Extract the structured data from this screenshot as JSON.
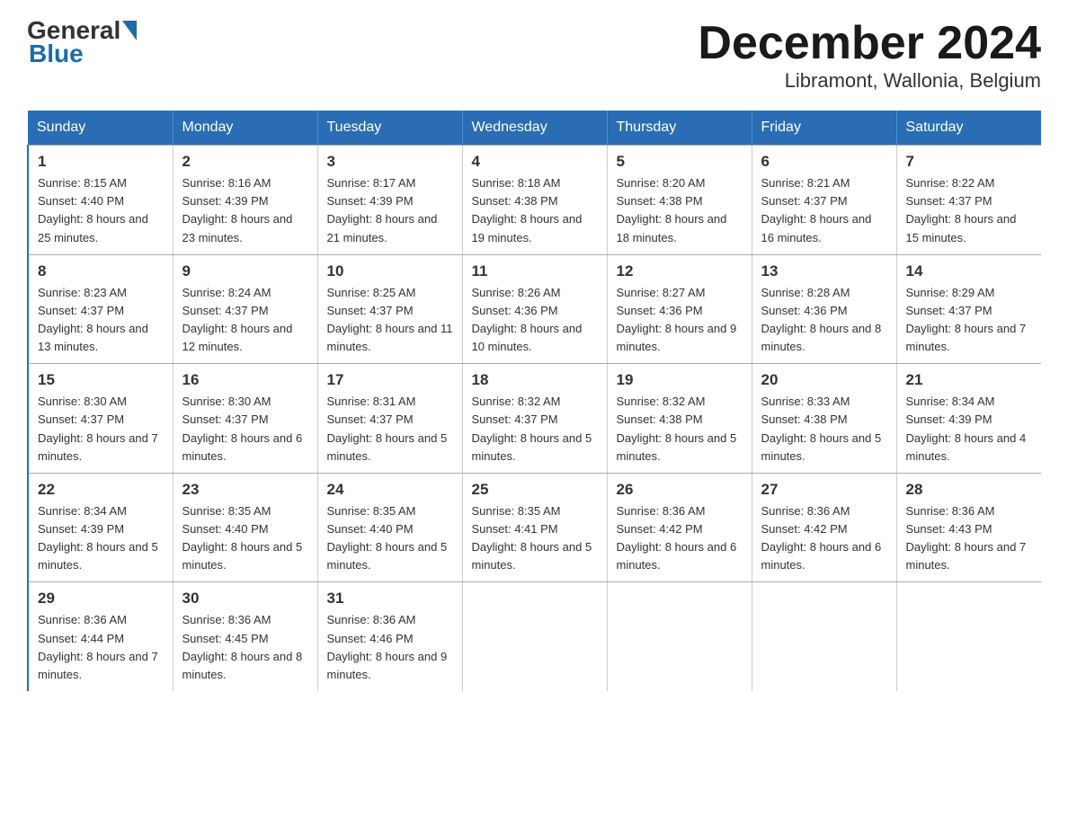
{
  "header": {
    "logo_general": "General",
    "logo_blue": "Blue",
    "title": "December 2024",
    "subtitle": "Libramont, Wallonia, Belgium"
  },
  "days_of_week": [
    "Sunday",
    "Monday",
    "Tuesday",
    "Wednesday",
    "Thursday",
    "Friday",
    "Saturday"
  ],
  "weeks": [
    [
      {
        "date": "1",
        "sunrise": "Sunrise: 8:15 AM",
        "sunset": "Sunset: 4:40 PM",
        "daylight": "Daylight: 8 hours and 25 minutes."
      },
      {
        "date": "2",
        "sunrise": "Sunrise: 8:16 AM",
        "sunset": "Sunset: 4:39 PM",
        "daylight": "Daylight: 8 hours and 23 minutes."
      },
      {
        "date": "3",
        "sunrise": "Sunrise: 8:17 AM",
        "sunset": "Sunset: 4:39 PM",
        "daylight": "Daylight: 8 hours and 21 minutes."
      },
      {
        "date": "4",
        "sunrise": "Sunrise: 8:18 AM",
        "sunset": "Sunset: 4:38 PM",
        "daylight": "Daylight: 8 hours and 19 minutes."
      },
      {
        "date": "5",
        "sunrise": "Sunrise: 8:20 AM",
        "sunset": "Sunset: 4:38 PM",
        "daylight": "Daylight: 8 hours and 18 minutes."
      },
      {
        "date": "6",
        "sunrise": "Sunrise: 8:21 AM",
        "sunset": "Sunset: 4:37 PM",
        "daylight": "Daylight: 8 hours and 16 minutes."
      },
      {
        "date": "7",
        "sunrise": "Sunrise: 8:22 AM",
        "sunset": "Sunset: 4:37 PM",
        "daylight": "Daylight: 8 hours and 15 minutes."
      }
    ],
    [
      {
        "date": "8",
        "sunrise": "Sunrise: 8:23 AM",
        "sunset": "Sunset: 4:37 PM",
        "daylight": "Daylight: 8 hours and 13 minutes."
      },
      {
        "date": "9",
        "sunrise": "Sunrise: 8:24 AM",
        "sunset": "Sunset: 4:37 PM",
        "daylight": "Daylight: 8 hours and 12 minutes."
      },
      {
        "date": "10",
        "sunrise": "Sunrise: 8:25 AM",
        "sunset": "Sunset: 4:37 PM",
        "daylight": "Daylight: 8 hours and 11 minutes."
      },
      {
        "date": "11",
        "sunrise": "Sunrise: 8:26 AM",
        "sunset": "Sunset: 4:36 PM",
        "daylight": "Daylight: 8 hours and 10 minutes."
      },
      {
        "date": "12",
        "sunrise": "Sunrise: 8:27 AM",
        "sunset": "Sunset: 4:36 PM",
        "daylight": "Daylight: 8 hours and 9 minutes."
      },
      {
        "date": "13",
        "sunrise": "Sunrise: 8:28 AM",
        "sunset": "Sunset: 4:36 PM",
        "daylight": "Daylight: 8 hours and 8 minutes."
      },
      {
        "date": "14",
        "sunrise": "Sunrise: 8:29 AM",
        "sunset": "Sunset: 4:37 PM",
        "daylight": "Daylight: 8 hours and 7 minutes."
      }
    ],
    [
      {
        "date": "15",
        "sunrise": "Sunrise: 8:30 AM",
        "sunset": "Sunset: 4:37 PM",
        "daylight": "Daylight: 8 hours and 7 minutes."
      },
      {
        "date": "16",
        "sunrise": "Sunrise: 8:30 AM",
        "sunset": "Sunset: 4:37 PM",
        "daylight": "Daylight: 8 hours and 6 minutes."
      },
      {
        "date": "17",
        "sunrise": "Sunrise: 8:31 AM",
        "sunset": "Sunset: 4:37 PM",
        "daylight": "Daylight: 8 hours and 5 minutes."
      },
      {
        "date": "18",
        "sunrise": "Sunrise: 8:32 AM",
        "sunset": "Sunset: 4:37 PM",
        "daylight": "Daylight: 8 hours and 5 minutes."
      },
      {
        "date": "19",
        "sunrise": "Sunrise: 8:32 AM",
        "sunset": "Sunset: 4:38 PM",
        "daylight": "Daylight: 8 hours and 5 minutes."
      },
      {
        "date": "20",
        "sunrise": "Sunrise: 8:33 AM",
        "sunset": "Sunset: 4:38 PM",
        "daylight": "Daylight: 8 hours and 5 minutes."
      },
      {
        "date": "21",
        "sunrise": "Sunrise: 8:34 AM",
        "sunset": "Sunset: 4:39 PM",
        "daylight": "Daylight: 8 hours and 4 minutes."
      }
    ],
    [
      {
        "date": "22",
        "sunrise": "Sunrise: 8:34 AM",
        "sunset": "Sunset: 4:39 PM",
        "daylight": "Daylight: 8 hours and 5 minutes."
      },
      {
        "date": "23",
        "sunrise": "Sunrise: 8:35 AM",
        "sunset": "Sunset: 4:40 PM",
        "daylight": "Daylight: 8 hours and 5 minutes."
      },
      {
        "date": "24",
        "sunrise": "Sunrise: 8:35 AM",
        "sunset": "Sunset: 4:40 PM",
        "daylight": "Daylight: 8 hours and 5 minutes."
      },
      {
        "date": "25",
        "sunrise": "Sunrise: 8:35 AM",
        "sunset": "Sunset: 4:41 PM",
        "daylight": "Daylight: 8 hours and 5 minutes."
      },
      {
        "date": "26",
        "sunrise": "Sunrise: 8:36 AM",
        "sunset": "Sunset: 4:42 PM",
        "daylight": "Daylight: 8 hours and 6 minutes."
      },
      {
        "date": "27",
        "sunrise": "Sunrise: 8:36 AM",
        "sunset": "Sunset: 4:42 PM",
        "daylight": "Daylight: 8 hours and 6 minutes."
      },
      {
        "date": "28",
        "sunrise": "Sunrise: 8:36 AM",
        "sunset": "Sunset: 4:43 PM",
        "daylight": "Daylight: 8 hours and 7 minutes."
      }
    ],
    [
      {
        "date": "29",
        "sunrise": "Sunrise: 8:36 AM",
        "sunset": "Sunset: 4:44 PM",
        "daylight": "Daylight: 8 hours and 7 minutes."
      },
      {
        "date": "30",
        "sunrise": "Sunrise: 8:36 AM",
        "sunset": "Sunset: 4:45 PM",
        "daylight": "Daylight: 8 hours and 8 minutes."
      },
      {
        "date": "31",
        "sunrise": "Sunrise: 8:36 AM",
        "sunset": "Sunset: 4:46 PM",
        "daylight": "Daylight: 8 hours and 9 minutes."
      },
      {
        "date": "",
        "sunrise": "",
        "sunset": "",
        "daylight": ""
      },
      {
        "date": "",
        "sunrise": "",
        "sunset": "",
        "daylight": ""
      },
      {
        "date": "",
        "sunrise": "",
        "sunset": "",
        "daylight": ""
      },
      {
        "date": "",
        "sunrise": "",
        "sunset": "",
        "daylight": ""
      }
    ]
  ]
}
